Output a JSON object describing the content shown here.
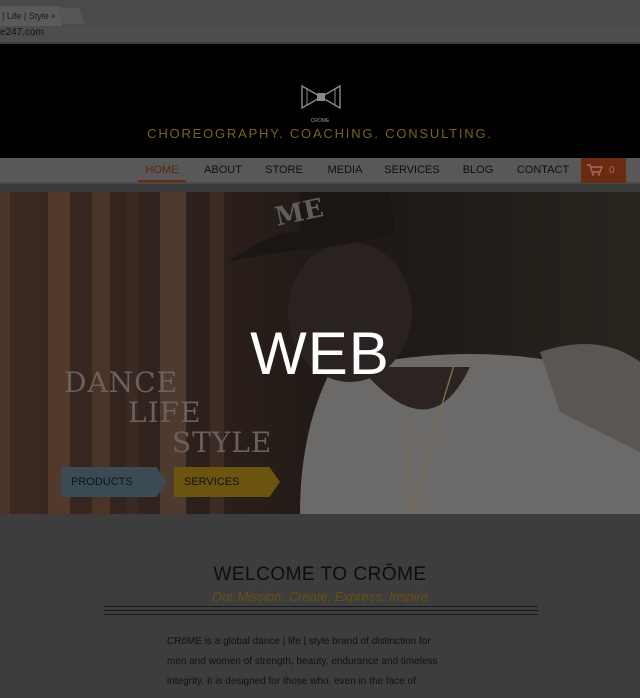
{
  "browser": {
    "tab_title": "| Life | Style",
    "tab_close": "×",
    "url": "e247.com"
  },
  "header": {
    "logo_text": "CRŌME",
    "tagline": "CHOREOGRAPHY. COACHING. CONSULTING."
  },
  "nav": {
    "items": [
      "HOME",
      "ABOUT",
      "STORE",
      "MEDIA",
      "SERVICES",
      "BLOG",
      "CONTACT"
    ],
    "active": "HOME",
    "cart_count": "0"
  },
  "hero": {
    "lines": [
      "DANCE",
      "LIFE",
      "STYLE"
    ],
    "buttons": [
      "PRODUCTS",
      "SERVICES"
    ],
    "cap_text": "ME",
    "overlay": "WEB"
  },
  "welcome": {
    "title": "WELCOME TO CRŌME",
    "mission": "Our Mission: Create, Express, Inspire",
    "body": [
      "CRōME is a global dance | life | style brand of distinction for",
      "men and women of strength, beauty, endurance and timeless",
      "integrity. It is designed for those who, even in the face of"
    ]
  },
  "colors": {
    "accent_gold": "#7a6220",
    "nav_active": "#5a2310",
    "cart_bg": "#6a2c10",
    "products_btn": "#3b4b55",
    "services_btn": "#6b5310"
  }
}
